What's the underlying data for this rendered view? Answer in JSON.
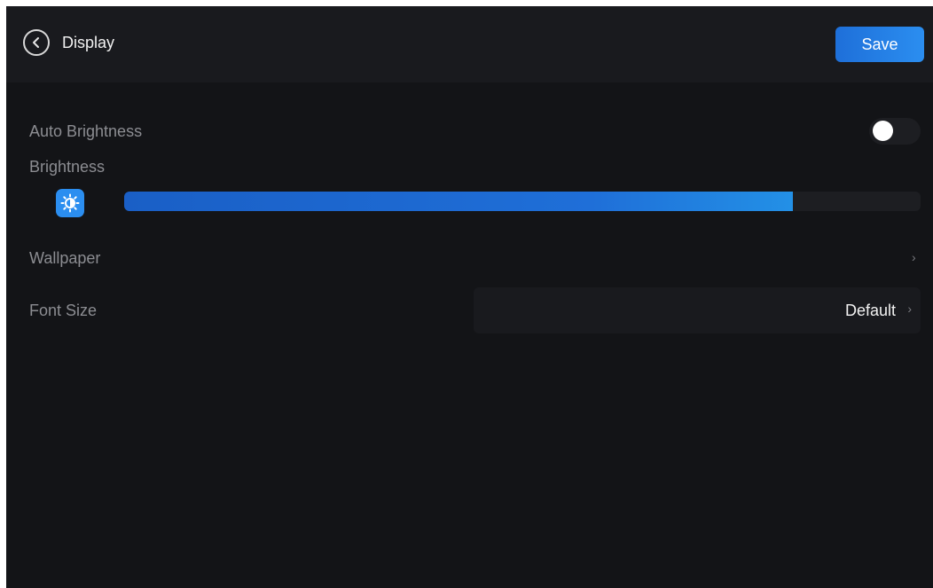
{
  "header": {
    "title": "Display",
    "save_label": "Save"
  },
  "settings": {
    "auto_brightness": {
      "label": "Auto Brightness",
      "enabled": false
    },
    "brightness": {
      "label": "Brightness",
      "level_percent": 84
    },
    "wallpaper": {
      "label": "Wallpaper"
    },
    "font_size": {
      "label": "Font Size",
      "value": "Default"
    }
  },
  "icons": {
    "back": "chevron-left-icon",
    "brightness": "sun-icon",
    "chevron": "chevron-right-icon"
  },
  "colors": {
    "background": "#131417",
    "header": "#191a1e",
    "accent": "#2b8ef0",
    "label": "#8c8d92"
  }
}
